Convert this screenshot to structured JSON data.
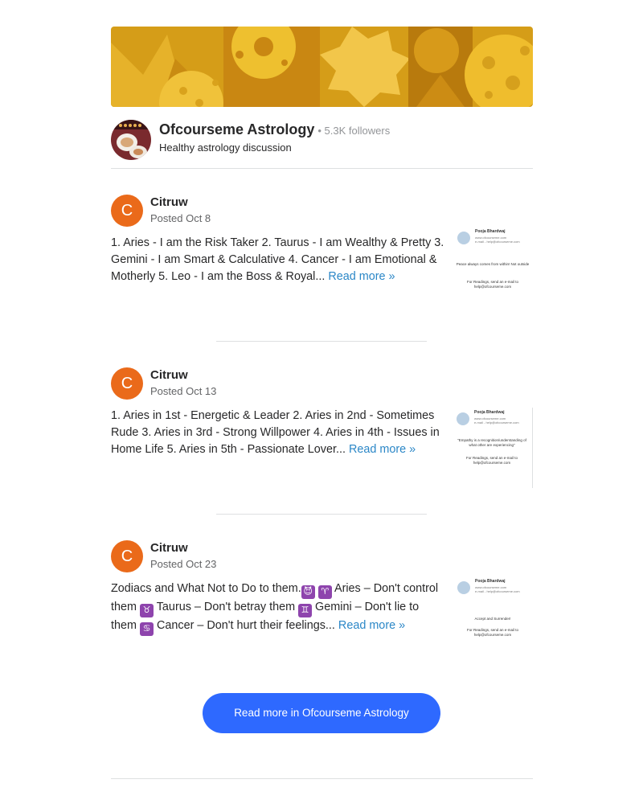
{
  "space": {
    "name": "Ofcourseme Astrology",
    "followers": "• 5.3K followers",
    "description": "Healthy astrology discussion"
  },
  "posts": [
    {
      "author_initial": "C",
      "author": "Citruw",
      "date": "Posted Oct 8",
      "text": "1. Aries - I am the Risk Taker 2. Taurus - I am Wealthy & Pretty 3. Gemini - I am Smart & Calculative 4. Cancer - I am Emotional & Motherly 5. Leo - I am the Boss & Royal...",
      "read_more": "Read more »",
      "thumb": {
        "name": "Pooja Bhardwaj",
        "line1": "www.ofcourseme.com",
        "line2": "e-mail - help@ofcourseme.com",
        "quote": "Peace always comes from within! Not outside",
        "footer": "For Readings, send an e-mail to help@ofcourseme.com"
      }
    },
    {
      "author_initial": "C",
      "author": "Citruw",
      "date": "Posted Oct 13",
      "text": "1. Aries in 1st - Energetic & Leader 2. Aries in 2nd - Sometimes Rude 3. Aries in 3rd - Strong Willpower 4. Aries in 4th - Issues in Home Life 5. Aries in 5th - Passionate Lover...",
      "read_more": "Read more »",
      "thumb": {
        "name": "Pooja Bhardwaj",
        "line1": "www.ofcourseme.com",
        "line2": "e-mail - help@ofcourseme.com",
        "quote": "\"Empathy is a recognition/understanding of what other are experiencing\"",
        "footer": "For Readings, send an e-mail to help@ofcourseme.com"
      }
    },
    {
      "author_initial": "C",
      "author": "Citruw",
      "date": "Posted Oct 23",
      "text_parts": [
        "Zodiacs and What Not to Do to them.",
        " Aries – Don't control them ",
        " Taurus – Don't betray them ",
        " Gemini – Don't lie to them ",
        " Cancer – Don't hurt their feelings..."
      ],
      "emojis": [
        "😈",
        "♈",
        "♉",
        "♊",
        "♋"
      ],
      "read_more": "Read more »",
      "thumb": {
        "name": "Pooja Bhardwaj",
        "line1": "www.ofcourseme.com",
        "line2": "e-mail - help@ofcourseme.com",
        "quote": "Accept and Surrender!",
        "footer": "For Readings, send an e-mail to help@ofcourseme.com"
      }
    }
  ],
  "cta": {
    "label": "Read more in Ofcourseme Astrology"
  },
  "colors": {
    "accent": "#2e69ff",
    "link": "#2b87c7",
    "avatar": "#ea6a1a",
    "zodiac_badge": "#8e44ad"
  }
}
